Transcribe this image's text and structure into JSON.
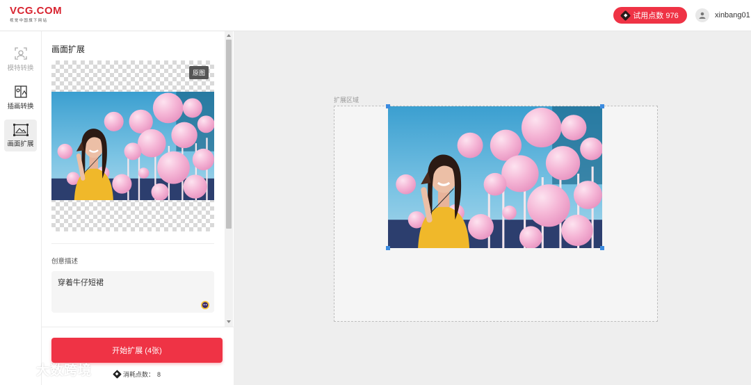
{
  "header": {
    "logo": "VCG.COM",
    "logo_sub": "视觉中国旗下网站",
    "points_label": "试用点数 976",
    "points_icon": "diamond-point-icon",
    "username": "xinbang01",
    "avatar_icon": "user-avatar-icon"
  },
  "rail": {
    "items": [
      {
        "label": "模特转换",
        "icon": "model-swap-icon",
        "active": false
      },
      {
        "label": "插画转换",
        "icon": "illustration-swap-icon",
        "active": false
      },
      {
        "label": "画面扩展",
        "icon": "image-expand-icon",
        "active": true
      }
    ]
  },
  "panel": {
    "title": "画面扩展",
    "original_tag": "原图",
    "desc_label": "创意描述",
    "desc_value": "穿着牛仔短裙",
    "start_button": "开始扩展 (4张)",
    "cost_label": "消耗点数：",
    "cost_value": "8"
  },
  "canvas": {
    "label": "扩展区域"
  },
  "watermark": {
    "text": "大数跨境"
  },
  "colors": {
    "accent": "#ef3345",
    "handle": "#3b8be0",
    "brand": "#d8232f"
  }
}
